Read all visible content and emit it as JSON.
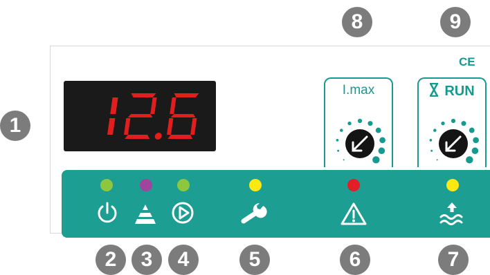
{
  "display": {
    "value": "12.6",
    "digit_color": "#e01e1e",
    "background": "#1a1a1a"
  },
  "marks": {
    "ce": "CE"
  },
  "knobs": {
    "imax": {
      "label": "I.max"
    },
    "run": {
      "label": "RUN",
      "icon": "hourglass-icon"
    }
  },
  "badges": [
    "1",
    "2",
    "3",
    "4",
    "5",
    "6",
    "7",
    "8",
    "9"
  ],
  "indicators": [
    {
      "name": "power",
      "icon": "power-icon",
      "led_color": "#8dc63f"
    },
    {
      "name": "level",
      "icon": "level-signal-icon",
      "led_color": "#a0459b"
    },
    {
      "name": "pump-run",
      "icon": "play-circle-icon",
      "led_color": "#8dc63f"
    },
    {
      "name": "service",
      "icon": "wrench-icon",
      "led_color": "#ffe812"
    },
    {
      "name": "alarm",
      "icon": "warning-icon",
      "led_color": "#e21e26"
    },
    {
      "name": "water-level",
      "icon": "water-level-icon",
      "led_color": "#ffe812"
    }
  ],
  "colors": {
    "accent": "#16998f",
    "strip": "#1d9e92",
    "badge": "#7c7c7c"
  }
}
